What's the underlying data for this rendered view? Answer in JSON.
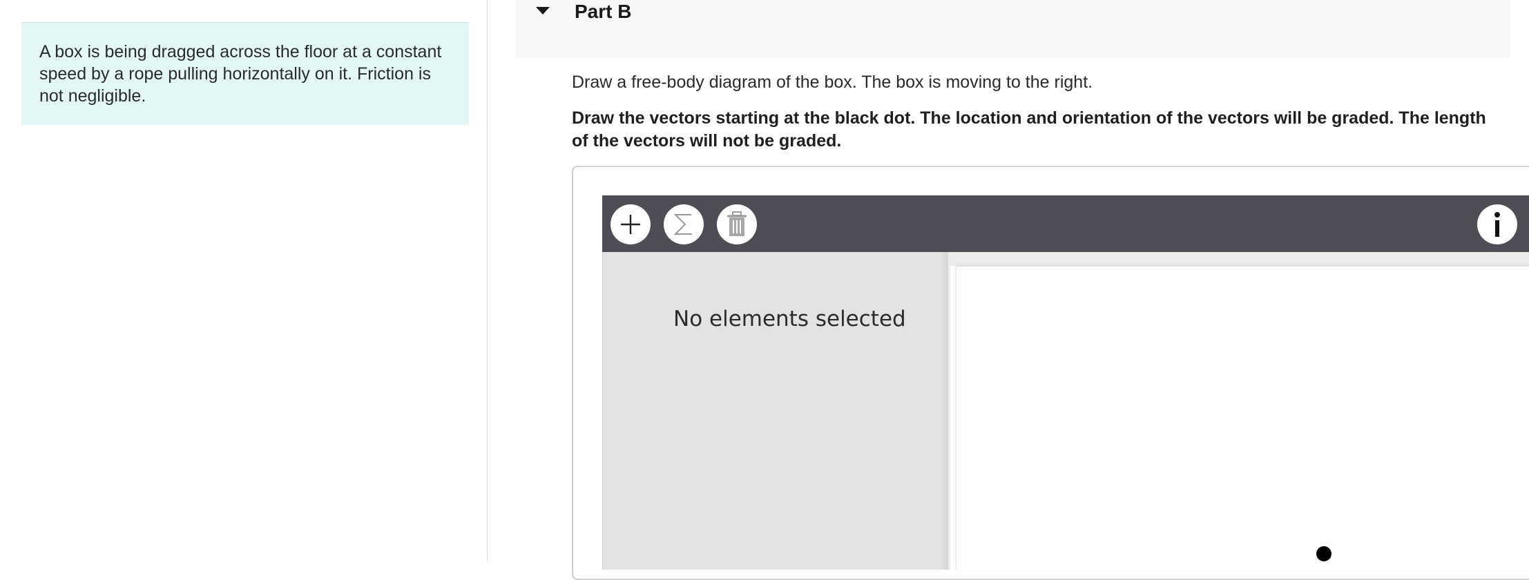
{
  "problem": {
    "text": " A box is being dragged across the floor at a constant speed by a rope pulling horizontally on it. Friction is not negligible."
  },
  "part": {
    "title": "Part B"
  },
  "instructions": {
    "prompt": "Draw a free-body diagram of the box. The box is moving to the right.",
    "grading_note": "Draw the vectors starting at the black dot. The location and orientation of the vectors will be graded. The length of the vectors will not be graded."
  },
  "toolbar": {
    "icons": [
      "plus-icon",
      "sigma-icon",
      "trash-icon",
      "info-icon"
    ]
  },
  "side_panel": {
    "status": "No elements selected"
  },
  "colors": {
    "problem_bg": "#e3f7f7",
    "toolbar_bg": "#4c4d55",
    "side_panel_bg": "#e3e3e3",
    "header_bg": "#f7f7f7"
  }
}
